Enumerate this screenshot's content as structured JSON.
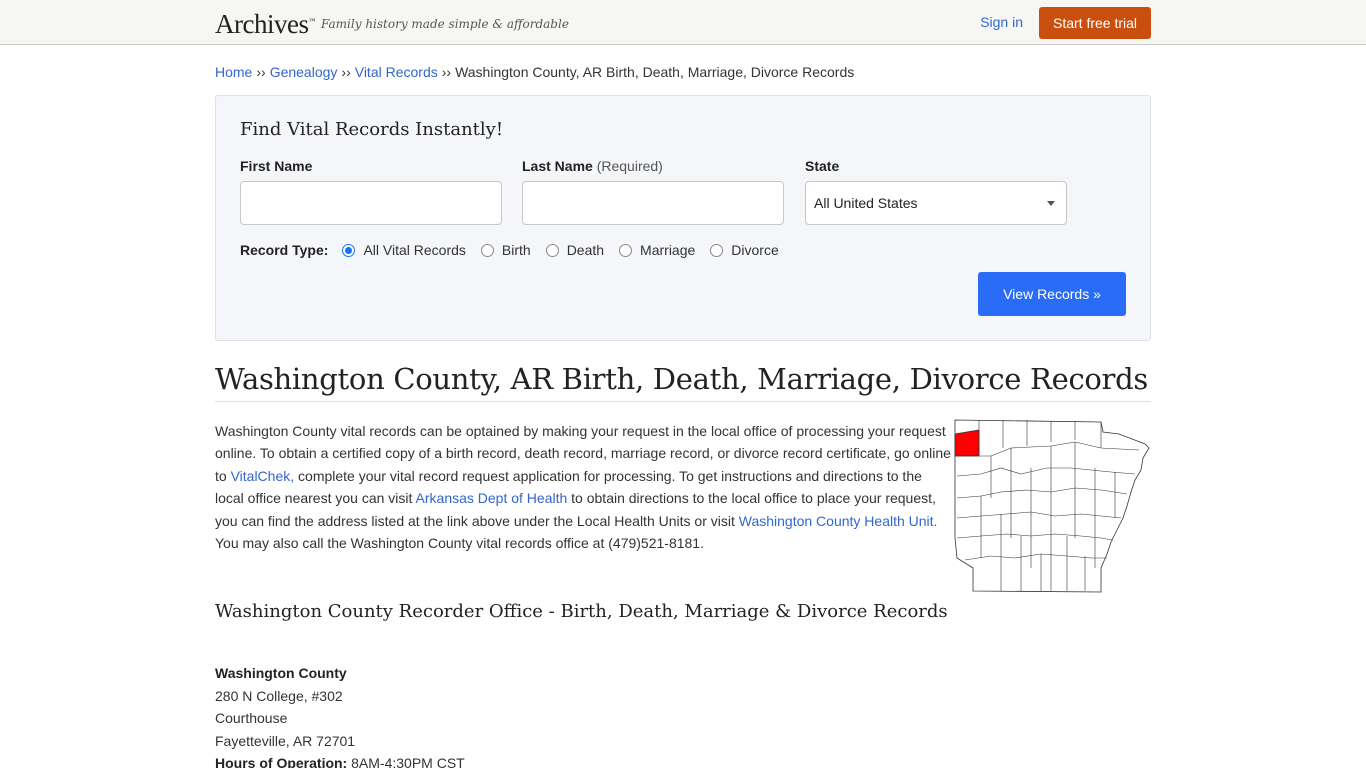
{
  "header": {
    "logo": "Archives",
    "logo_tm": "™",
    "tagline": "Family history made simple & affordable",
    "signin_label": "Sign in",
    "trial_label": "Start free trial"
  },
  "breadcrumb": {
    "items": [
      {
        "label": "Home",
        "link": true
      },
      {
        "label": "Genealogy",
        "link": true
      },
      {
        "label": "Vital Records",
        "link": true
      },
      {
        "label": "Washington County, AR Birth, Death, Marriage, Divorce Records",
        "link": false
      }
    ],
    "separator": "››"
  },
  "search": {
    "title": "Find Vital Records Instantly!",
    "first_name_label": "First Name",
    "first_name_value": "",
    "last_name_label": "Last Name",
    "last_name_note": "(Required)",
    "last_name_value": "",
    "state_label": "State",
    "state_value": "All United States",
    "record_type_label": "Record Type:",
    "record_types": [
      {
        "label": "All Vital Records",
        "checked": true
      },
      {
        "label": "Birth",
        "checked": false
      },
      {
        "label": "Death",
        "checked": false
      },
      {
        "label": "Marriage",
        "checked": false
      },
      {
        "label": "Divorce",
        "checked": false
      }
    ],
    "submit_label": "View Records »"
  },
  "page": {
    "title": "Washington County, AR Birth, Death, Marriage, Divorce Records",
    "intro_parts": {
      "p1": "Washington County vital records can be optained by making your request in the local office of processing your request online. To obtain a certified copy of a birth record, death record, marriage record, or divorce record certificate, go online to ",
      "link1": "VitalChek,",
      "p2": " complete your vital record request application for processing. To get instructions and directions to the local office nearest you can visit ",
      "link2": "Arkansas Dept of Health",
      "p3": " to obtain directions to the local office to place your request, you can find the address listed at the link above under the Local Health Units or visit ",
      "link3": "Washington County Health Unit.",
      "p4": " You may also call the Washington County vital records office at (479)521-8181."
    },
    "map_alt": "Arkansas county map highlighting Washington County",
    "section_title": "Washington County Recorder Office - Birth, Death, Marriage & Divorce Records",
    "office": {
      "name": "Washington County",
      "address1": "280 N College, #302",
      "address2": "Courthouse",
      "city_line": "Fayetteville, AR 72701",
      "hours_label": "Hours of Operation:",
      "hours_value": "8AM-4:30PM CST"
    }
  },
  "colors": {
    "link": "#3366cc",
    "trial_button": "#c94f0f",
    "view_button": "#2b6cf6",
    "map_highlight": "#ff0000"
  }
}
